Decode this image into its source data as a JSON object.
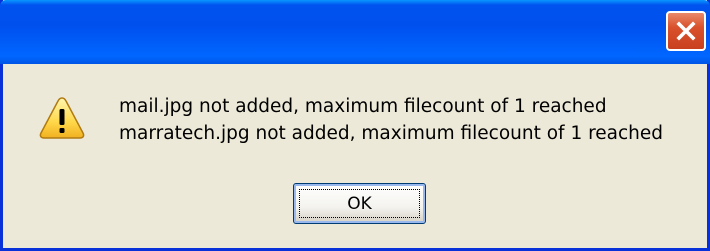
{
  "dialog": {
    "icon": "warning-icon",
    "messages": [
      "mail.jpg not added, maximum filecount of 1 reached",
      "marratech.jpg not added, maximum filecount of 1 reached"
    ],
    "ok_label": "OK"
  },
  "titlebar": {
    "close_icon": "close-icon"
  },
  "colors": {
    "titlebar": "#0053EE",
    "close_button": "#D9512C",
    "dialog_background": "#ECE9D8",
    "border": "#0831D9"
  }
}
